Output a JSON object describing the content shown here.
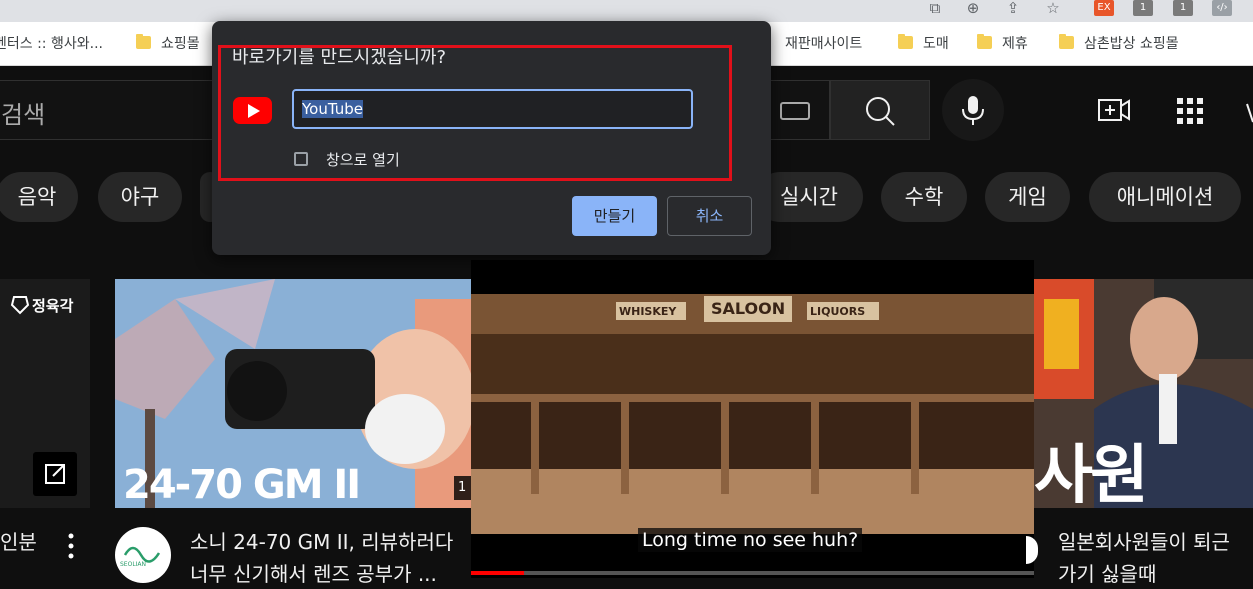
{
  "bookmarks": [
    {
      "label": "벤터스 :: 행사와...",
      "folder": false
    },
    {
      "label": "쇼핑몰",
      "folder": true
    },
    {
      "label": "재판매사이트",
      "folder": false
    },
    {
      "label": "도매",
      "folder": true
    },
    {
      "label": "제휴",
      "folder": true
    },
    {
      "label": "삼촌밥상 쇼핑몰",
      "folder": true
    }
  ],
  "toolbar_ext_label": "EX",
  "search": {
    "placeholder": "검색"
  },
  "chips": [
    "음악",
    "야구",
    "실시간",
    "수학",
    "게임",
    "애니메이션"
  ],
  "dialog": {
    "title": "바로가기를 만드시겠습니까?",
    "name_value": "YouTube",
    "open_window_label": "창으로 열기",
    "open_window_checked": false,
    "create_label": "만들기",
    "cancel_label": "취소"
  },
  "videos": [
    {
      "title_line1": "인분",
      "channel_badge": "정육각"
    },
    {
      "thumb_text": "24-70 GM II",
      "title_line1": "소니 24-70 GM II, 리뷰하러다",
      "title_line2": "너무 신기해서 렌즈 공부가 ...",
      "channel_avatar": "SEOLIAN"
    },
    {
      "caption": "Long time no see huh?",
      "sign_left": "WHISKEY",
      "sign_mid": "SALOON",
      "sign_right": "LIQUORS"
    },
    {
      "thumb_text": "사원",
      "title_line1": "일본회사원들이 퇴근",
      "title_line2": "가기 싫을때"
    }
  ],
  "colors": {
    "accent": "#8ab4f8",
    "highlight": "#e1101a",
    "youtube_red": "#ff0000"
  }
}
